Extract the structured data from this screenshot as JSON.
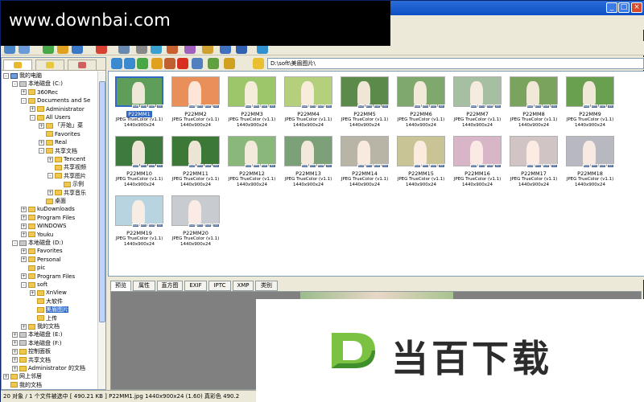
{
  "watermark": "www.downbai.com",
  "window_controls": {
    "minimize": "_",
    "maximize": "□",
    "close": "×"
  },
  "address": {
    "path": "D:\\soft\\美眉图片\\"
  },
  "left_tabs": [
    "folders",
    "favorites",
    "categories"
  ],
  "tree": [
    {
      "label": "我的电脑",
      "indent": 0,
      "exp": "-",
      "icon": "pc"
    },
    {
      "label": "本地磁盘 (C:)",
      "indent": 1,
      "exp": "-",
      "icon": "drive"
    },
    {
      "label": "360Rec",
      "indent": 2,
      "exp": "+",
      "icon": "folder"
    },
    {
      "label": "Documents and Se",
      "indent": 2,
      "exp": "-",
      "icon": "folder"
    },
    {
      "label": "Administrator",
      "indent": 3,
      "exp": "+",
      "icon": "folder"
    },
    {
      "label": "All Users",
      "indent": 3,
      "exp": "-",
      "icon": "folder"
    },
    {
      "label": "「开始」菜",
      "indent": 4,
      "exp": "+",
      "icon": "folder"
    },
    {
      "label": "Favorites",
      "indent": 4,
      "exp": "",
      "icon": "folder"
    },
    {
      "label": "Real",
      "indent": 4,
      "exp": "+",
      "icon": "folder"
    },
    {
      "label": "共享文档",
      "indent": 4,
      "exp": "-",
      "icon": "folder"
    },
    {
      "label": "Tencent",
      "indent": 5,
      "exp": "+",
      "icon": "folder"
    },
    {
      "label": "共享视频",
      "indent": 5,
      "exp": "",
      "icon": "folder"
    },
    {
      "label": "共享图片",
      "indent": 5,
      "exp": "-",
      "icon": "folder"
    },
    {
      "label": "示例",
      "indent": 6,
      "exp": "",
      "icon": "folder"
    },
    {
      "label": "共享音乐",
      "indent": 5,
      "exp": "+",
      "icon": "folder"
    },
    {
      "label": "桌面",
      "indent": 4,
      "exp": "",
      "icon": "folder"
    },
    {
      "label": "kuDownloads",
      "indent": 2,
      "exp": "+",
      "icon": "folder"
    },
    {
      "label": "Program Files",
      "indent": 2,
      "exp": "+",
      "icon": "folder"
    },
    {
      "label": "WINDOWS",
      "indent": 2,
      "exp": "+",
      "icon": "folder"
    },
    {
      "label": "Youku",
      "indent": 2,
      "exp": "+",
      "icon": "folder"
    },
    {
      "label": "本地磁盘 (D:)",
      "indent": 1,
      "exp": "-",
      "icon": "drive"
    },
    {
      "label": "Favorites",
      "indent": 2,
      "exp": "+",
      "icon": "folder"
    },
    {
      "label": "Personal",
      "indent": 2,
      "exp": "+",
      "icon": "folder"
    },
    {
      "label": "pic",
      "indent": 2,
      "exp": "",
      "icon": "folder"
    },
    {
      "label": "Program Files",
      "indent": 2,
      "exp": "+",
      "icon": "folder"
    },
    {
      "label": "soft",
      "indent": 2,
      "exp": "-",
      "icon": "folder"
    },
    {
      "label": "XnView",
      "indent": 3,
      "exp": "+",
      "icon": "folder"
    },
    {
      "label": "大软件",
      "indent": 3,
      "exp": "",
      "icon": "folder"
    },
    {
      "label": "美眉图片",
      "indent": 3,
      "exp": "",
      "icon": "folder",
      "selected": true
    },
    {
      "label": "上传",
      "indent": 3,
      "exp": "",
      "icon": "folder"
    },
    {
      "label": "我的文档",
      "indent": 2,
      "exp": "+",
      "icon": "folder"
    },
    {
      "label": "本地磁盘 (E:)",
      "indent": 1,
      "exp": "+",
      "icon": "drive"
    },
    {
      "label": "本地磁盘 (F:)",
      "indent": 1,
      "exp": "+",
      "icon": "drive"
    },
    {
      "label": "控制面板",
      "indent": 1,
      "exp": "+",
      "icon": "folder"
    },
    {
      "label": "共享文档",
      "indent": 1,
      "exp": "+",
      "icon": "folder"
    },
    {
      "label": "Administrator 的文档",
      "indent": 1,
      "exp": "+",
      "icon": "folder"
    },
    {
      "label": "网上邻居",
      "indent": 0,
      "exp": "+",
      "icon": "folder"
    },
    {
      "label": "我的文档",
      "indent": 0,
      "exp": "",
      "icon": "folder"
    }
  ],
  "thumbnails": [
    {
      "name": "P22MM1",
      "selected": true,
      "bg": "#5f9e5a"
    },
    {
      "name": "P22MM2",
      "bg": "#e9905a"
    },
    {
      "name": "P22MM3",
      "bg": "#9cc66a"
    },
    {
      "name": "P22MM4",
      "bg": "#b4d07c"
    },
    {
      "name": "P22MM5",
      "bg": "#5c8a4a"
    },
    {
      "name": "P22MM6",
      "bg": "#7ea86c"
    },
    {
      "name": "P22MM7",
      "bg": "#a6bea2"
    },
    {
      "name": "P22MM8",
      "bg": "#7aa45e"
    },
    {
      "name": "P22MM9",
      "bg": "#68a050"
    },
    {
      "name": "P22MM10",
      "bg": "#3e7a3e"
    },
    {
      "name": "P22MM11",
      "bg": "#3c7836"
    },
    {
      "name": "P22MM12",
      "bg": "#8ab87a"
    },
    {
      "name": "P22MM13",
      "bg": "#7ca078"
    },
    {
      "name": "P22MM14",
      "bg": "#b8b4a6"
    },
    {
      "name": "P22MM15",
      "bg": "#c8c496"
    },
    {
      "name": "P22MM16",
      "bg": "#d8b6c8"
    },
    {
      "name": "P22MM17",
      "bg": "#d0c4c4"
    },
    {
      "name": "P22MM18",
      "bg": "#b8b8c0"
    },
    {
      "name": "P22MM19",
      "bg": "#b8d4e0"
    },
    {
      "name": "P22MM20",
      "bg": "#c8ccd0"
    }
  ],
  "thumb_info": "JPEG TrueColor (v1.1)",
  "thumb_size": "1440x900x24",
  "badges": [
    "RAW",
    "IPTC",
    "EXIF",
    "ICC"
  ],
  "preview_tabs": [
    "预览",
    "属性",
    "直方图",
    "EXIF",
    "IPTC",
    "XMP",
    "类别"
  ],
  "logo_text": "当百下载",
  "status": "20 对象 / 1 个文件被选中  [ 490.21 KB ]  P22MM1.jpg  1440x900x24 (1.60)  真彩色  490.2"
}
